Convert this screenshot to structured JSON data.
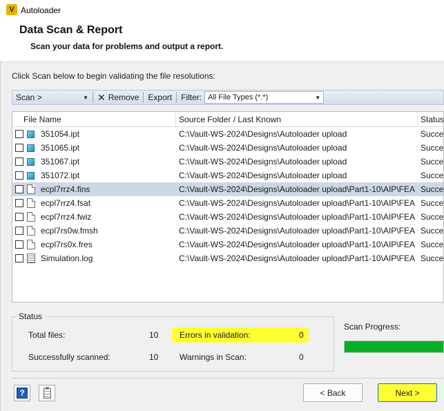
{
  "window": {
    "title": "Autoloader",
    "icon": "autoloader-v-icon"
  },
  "header": {
    "title": "Data Scan & Report",
    "subtitle": "Scan your data for problems and output a report."
  },
  "instruction": "Click Scan below to begin validating the file resolutions:",
  "toolbar": {
    "scan_label": "Scan >",
    "remove_label": "Remove",
    "export_label": "Export",
    "filter_label": "Filter:",
    "filter_value": "All File Types (*.*)"
  },
  "filelist": {
    "columns": [
      "File Name",
      "Source Folder / Last Known",
      "Status"
    ],
    "rows": [
      {
        "name": "351054.ipt",
        "source": "C:\\Vault-WS-2024\\Designs\\Autoloader upload",
        "status": "Succes",
        "icon": "part-icon",
        "checked": false,
        "selected": false
      },
      {
        "name": "351065.ipt",
        "source": "C:\\Vault-WS-2024\\Designs\\Autoloader upload",
        "status": "Succes",
        "icon": "part-icon",
        "checked": false,
        "selected": false
      },
      {
        "name": "351067.ipt",
        "source": "C:\\Vault-WS-2024\\Designs\\Autoloader upload",
        "status": "Succes",
        "icon": "part-icon",
        "checked": false,
        "selected": false
      },
      {
        "name": "351072.ipt",
        "source": "C:\\Vault-WS-2024\\Designs\\Autoloader upload",
        "status": "Succes",
        "icon": "part-icon",
        "checked": false,
        "selected": false
      },
      {
        "name": "ecpl7rrz4.fins",
        "source": "C:\\Vault-WS-2024\\Designs\\Autoloader upload\\Part1-10\\AIP\\FEA",
        "status": "Succes",
        "icon": "document-icon",
        "checked": false,
        "selected": true
      },
      {
        "name": "ecpl7rrz4.fsat",
        "source": "C:\\Vault-WS-2024\\Designs\\Autoloader upload\\Part1-10\\AIP\\FEA",
        "status": "Succes",
        "icon": "document-icon",
        "checked": false,
        "selected": false
      },
      {
        "name": "ecpl7rrz4.fwiz",
        "source": "C:\\Vault-WS-2024\\Designs\\Autoloader upload\\Part1-10\\AIP\\FEA",
        "status": "Succes",
        "icon": "document-icon",
        "checked": false,
        "selected": false
      },
      {
        "name": "ecpl7rs0w.fmsh",
        "source": "C:\\Vault-WS-2024\\Designs\\Autoloader upload\\Part1-10\\AIP\\FEA",
        "status": "Succes",
        "icon": "document-icon",
        "checked": false,
        "selected": false
      },
      {
        "name": "ecpl7rs0x.fres",
        "source": "C:\\Vault-WS-2024\\Designs\\Autoloader upload\\Part1-10\\AIP\\FEA",
        "status": "Succes",
        "icon": "document-icon",
        "checked": false,
        "selected": false
      },
      {
        "name": "Simulation.log",
        "source": "C:\\Vault-WS-2024\\Designs\\Autoloader upload\\Part1-10\\AIP\\FEA",
        "status": "Succes",
        "icon": "log-file-icon",
        "checked": false,
        "selected": false
      }
    ]
  },
  "status": {
    "legend": "Status",
    "total_files_label": "Total files:",
    "total_files": "10",
    "scanned_label": "Successfully scanned:",
    "scanned": "10",
    "errors_label": "Errors in validation:",
    "errors": "0",
    "warnings_label": "Warnings in Scan:",
    "warnings": "0"
  },
  "progress": {
    "label": "Scan Progress:",
    "fraction": 1.0,
    "color": "#06b025"
  },
  "footer": {
    "back_label": "< Back",
    "next_label": "Next >"
  },
  "highlight_color": "#ffff33"
}
